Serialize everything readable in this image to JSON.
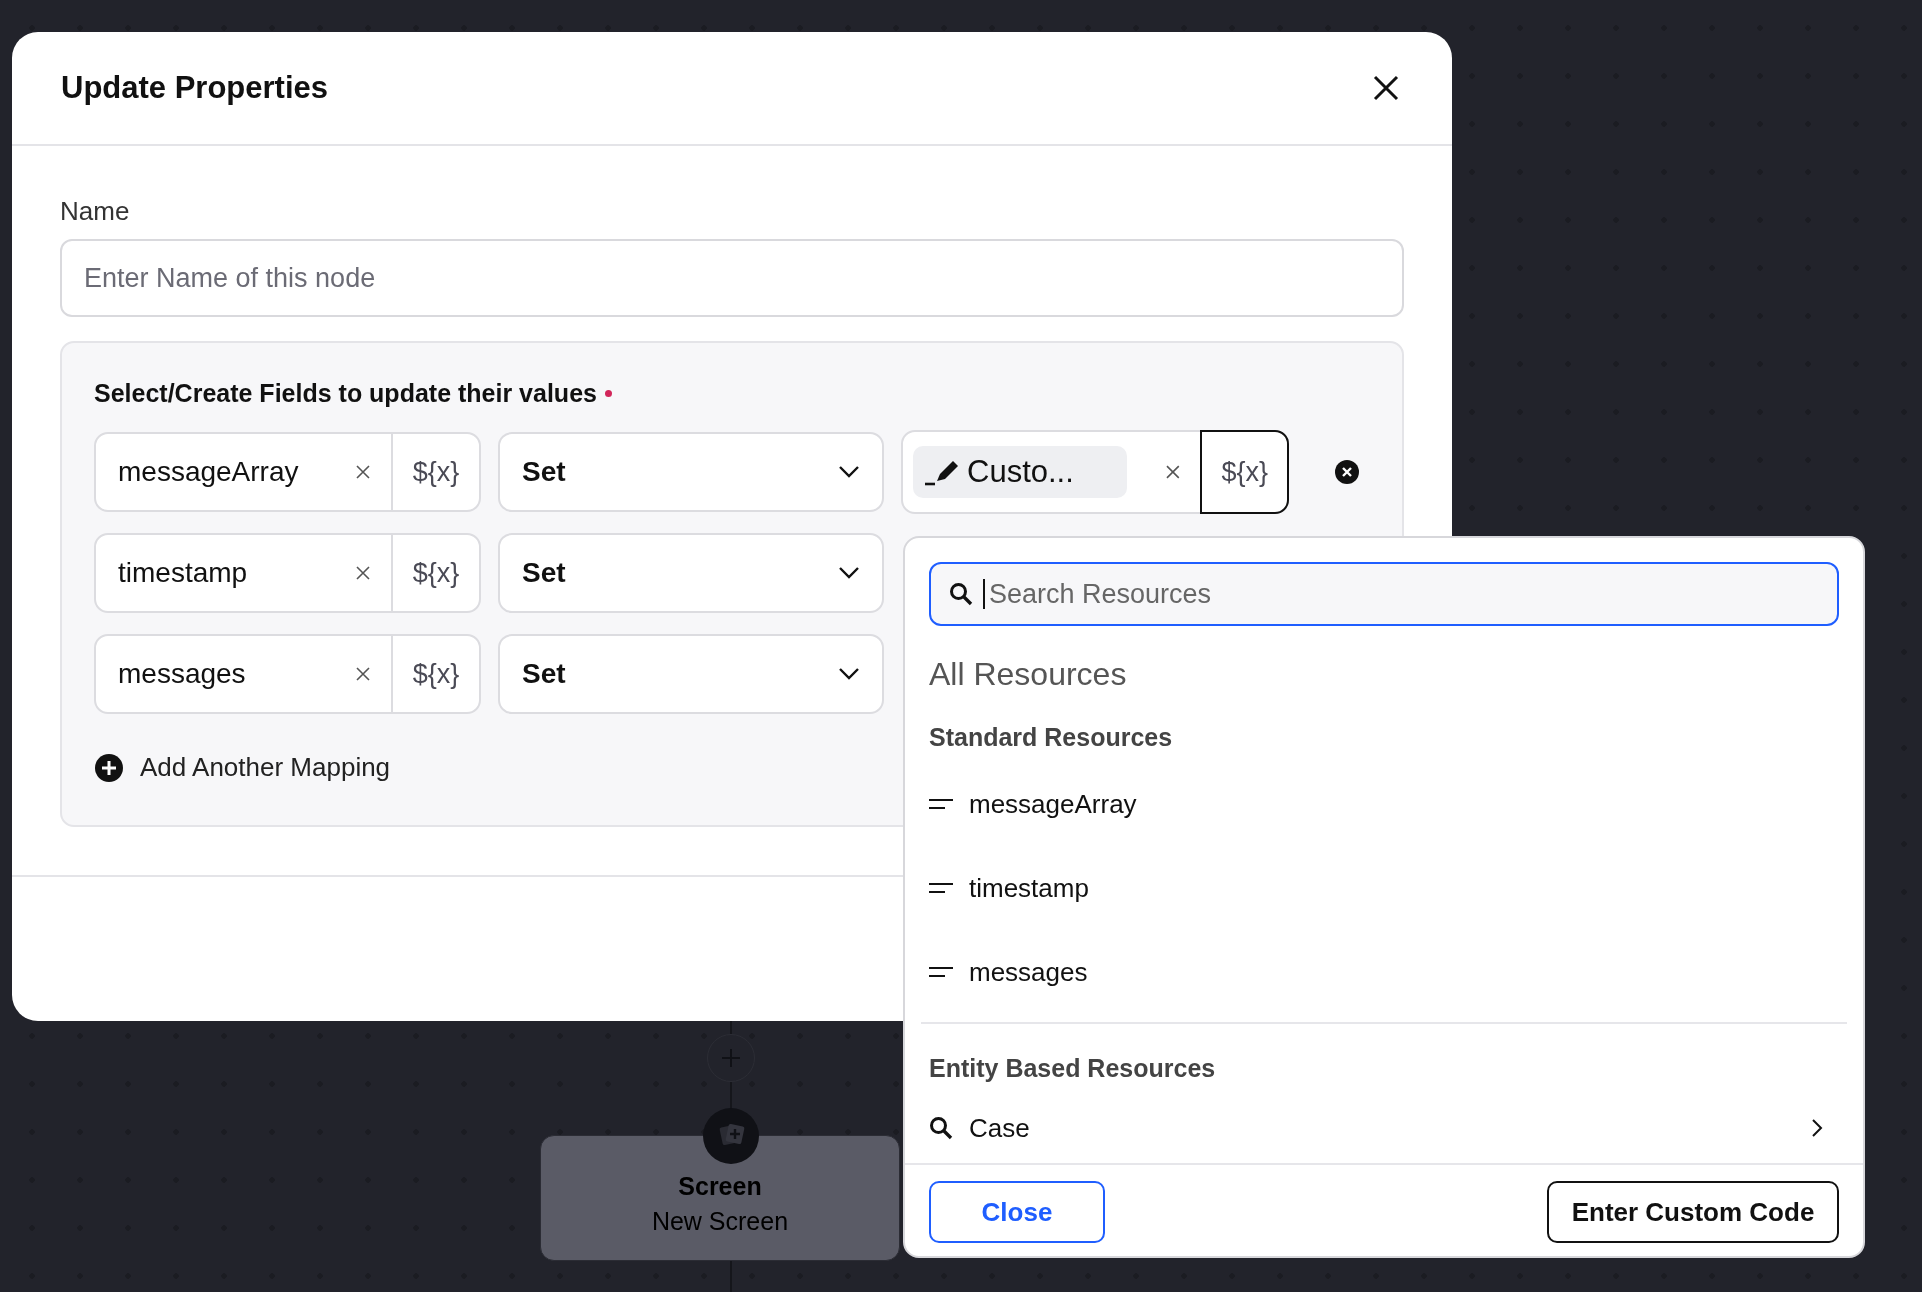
{
  "canvas": {
    "node": {
      "title": "Screen",
      "subtitle": "New Screen"
    }
  },
  "dialog": {
    "title": "Update Properties",
    "name_field": {
      "label": "Name",
      "placeholder": "Enter Name of this node"
    },
    "mappings": {
      "heading": "Select/Create Fields to update their values",
      "required": true,
      "rows": [
        {
          "field": "messageArray",
          "var_button": "${x}",
          "operator": "Set",
          "value": {
            "chip": "Custo...",
            "var_button": "${x}",
            "var_focused": true
          }
        },
        {
          "field": "timestamp",
          "var_button": "${x}",
          "operator": "Set"
        },
        {
          "field": "messages",
          "var_button": "${x}",
          "operator": "Set"
        }
      ],
      "add_label": "Add Another Mapping"
    }
  },
  "resource_picker": {
    "search": {
      "placeholder": "Search Resources"
    },
    "title": "All Resources",
    "sections": [
      {
        "heading": "Standard Resources",
        "items": [
          {
            "label": "messageArray",
            "kind": "variable"
          },
          {
            "label": "timestamp",
            "kind": "variable"
          },
          {
            "label": "messages",
            "kind": "variable"
          }
        ]
      },
      {
        "heading": "Entity Based Resources",
        "items": [
          {
            "label": "Case",
            "kind": "entity"
          }
        ]
      }
    ],
    "buttons": [
      {
        "label": "Close",
        "kind": "secondary"
      },
      {
        "label": "Enter Custom Code",
        "kind": "primary"
      }
    ]
  }
}
